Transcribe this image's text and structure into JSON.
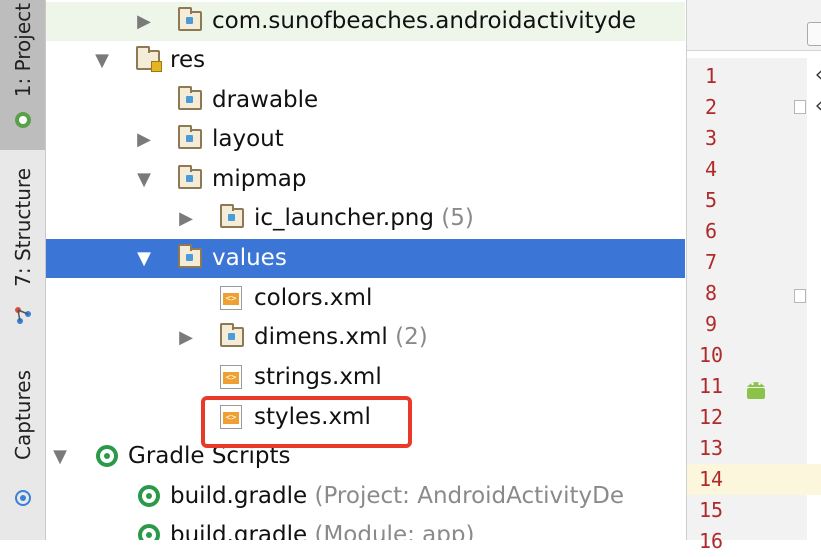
{
  "tool_tabs": {
    "project": "1: Project",
    "structure": "7: Structure",
    "captures": "Captures"
  },
  "tree": {
    "items": [
      {
        "label": "com.sunofbeaches.androidactivityde",
        "type": "package"
      },
      {
        "label": "res",
        "type": "folder"
      },
      {
        "label": "drawable",
        "type": "folder"
      },
      {
        "label": "layout",
        "type": "folder"
      },
      {
        "label": "mipmap",
        "type": "folder"
      },
      {
        "label": "ic_launcher.png",
        "extra": "(5)",
        "type": "folder"
      },
      {
        "label": "values",
        "type": "folder"
      },
      {
        "label": "colors.xml",
        "type": "xml"
      },
      {
        "label": "dimens.xml",
        "extra": "(2)",
        "type": "folder"
      },
      {
        "label": "strings.xml",
        "type": "xml"
      },
      {
        "label": "styles.xml",
        "type": "xml"
      },
      {
        "label": "Gradle Scripts",
        "type": "gradle"
      },
      {
        "label": "build.gradle",
        "extra": "(Project: AndroidActivityDe",
        "type": "gradle"
      },
      {
        "label": "build.gradle",
        "extra": "(Module: app)",
        "type": "gradle"
      }
    ]
  },
  "editor": {
    "line_numbers": [
      "1",
      "2",
      "3",
      "4",
      "5",
      "6",
      "7",
      "8",
      "9",
      "10",
      "11",
      "12",
      "13",
      "14",
      "15",
      "16"
    ],
    "current_line": "14"
  },
  "colors": {
    "selection": "#3b75d6",
    "highlight_box": "#e8392a",
    "line_number": "#b02a2a",
    "android_green": "#8bc34a"
  }
}
